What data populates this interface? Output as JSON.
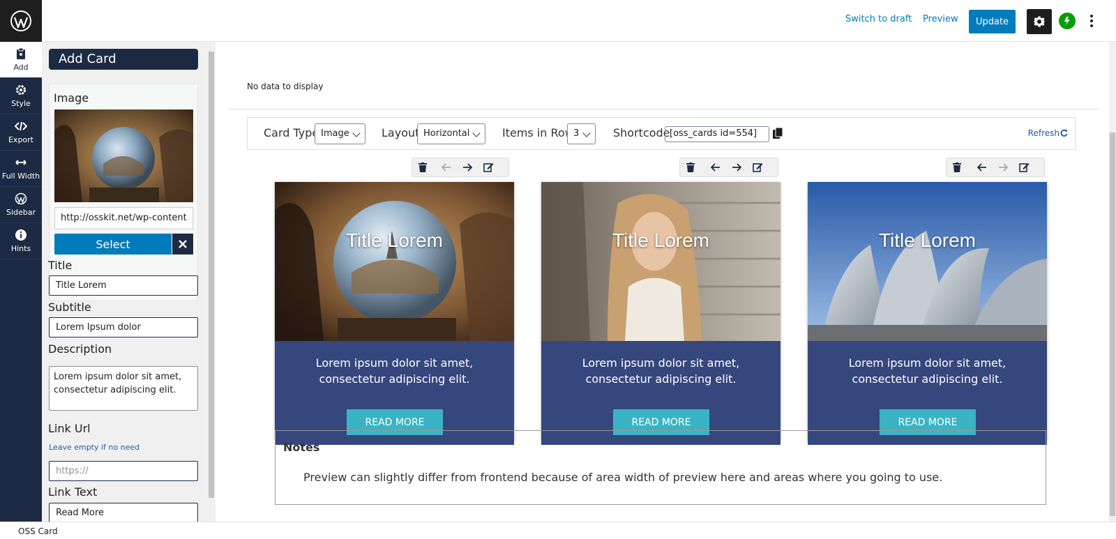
{
  "topbar": {
    "switch_to_draft": "Switch to draft",
    "preview": "Preview",
    "update": "Update"
  },
  "nav": [
    {
      "label": "Add",
      "icon": "clipboard-icon"
    },
    {
      "label": "Style",
      "icon": "gear-icon"
    },
    {
      "label": "Export",
      "icon": "code-icon"
    },
    {
      "label": "Full Width",
      "icon": "arrows-horizontal-icon"
    },
    {
      "label": "Sidebar",
      "icon": "wordpress-icon"
    },
    {
      "label": "Hints",
      "icon": "info-icon"
    }
  ],
  "panel": {
    "title": "Add Card",
    "image_label": "Image",
    "image_url": "http://osskit.net/wp-content",
    "select_label": "Select",
    "title_label": "Title",
    "title_value": "Title Lorem",
    "subtitle_label": "Subtitle",
    "subtitle_value": "Lorem Ipsum dolor",
    "description_label": "Description",
    "description_value": "Lorem ipsum dolor sit amet, consectetur adipiscing elit.",
    "link_url_label": "Link Url",
    "link_url_hint": "Leave empty if no need",
    "link_url_placeholder": "https://",
    "link_text_label": "Link Text",
    "link_text_value": "Read More"
  },
  "editor": {
    "no_data": "No data to display",
    "card_type_label": "Card Type",
    "card_type_value": "Image",
    "layout_label": "Layout",
    "layout_value": "Horizontal",
    "items_in_row_label": "Items in Row",
    "items_in_row_value": "3",
    "shortcode_label": "Shortcode",
    "shortcode_value": "[oss_cards id=554]",
    "refresh_label": "Refresh"
  },
  "cards": [
    {
      "title": "Title Lorem",
      "description": "Lorem ipsum dolor sit amet, consectetur adipiscing elit.",
      "button": "READ MORE"
    },
    {
      "title": "Title Lorem",
      "description": "Lorem ipsum dolor sit amet, consectetur adipiscing elit.",
      "button": "READ MORE"
    },
    {
      "title": "Title Lorem",
      "description": "Lorem ipsum dolor sit amet, consectetur adipiscing elit.",
      "button": "READ MORE"
    }
  ],
  "notes": {
    "title": "Notes",
    "text": "Preview can slightly differ from frontend because of area width of preview here and areas where you going to use."
  },
  "status_bar": "OSS Card",
  "colors": {
    "nav_bg": "#1d2a43",
    "accent": "#007cba",
    "card_body": "#35477d",
    "card_button": "#3ab4c4"
  }
}
